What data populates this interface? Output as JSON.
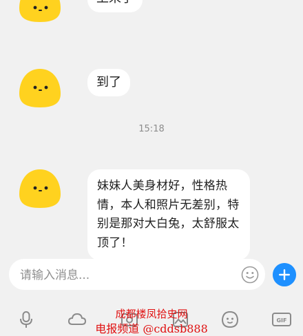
{
  "messages": [
    {
      "text": "上来了"
    },
    {
      "text": "到了"
    },
    {
      "text": "妹妹人美身材好，性格热情，本人和照片无差别，特别是那对大白兔，太舒服太顶了！"
    }
  ],
  "timestamp": "15:18",
  "input": {
    "placeholder": "请输入消息..."
  },
  "toolbar": {
    "icons": [
      "microphone-icon",
      "cloud-icon",
      "photo-icon",
      "image-icon",
      "smiley-icon",
      "gif-icon"
    ]
  },
  "watermark": {
    "line1": "成都楼凤拾史网",
    "line2": "电报频道 @cddsb888"
  },
  "colors": {
    "background": "#f1f1f1",
    "bubble": "#ffffff",
    "avatar": "#ffd21f",
    "send": "#1e90ff",
    "watermark": "#e01010"
  }
}
